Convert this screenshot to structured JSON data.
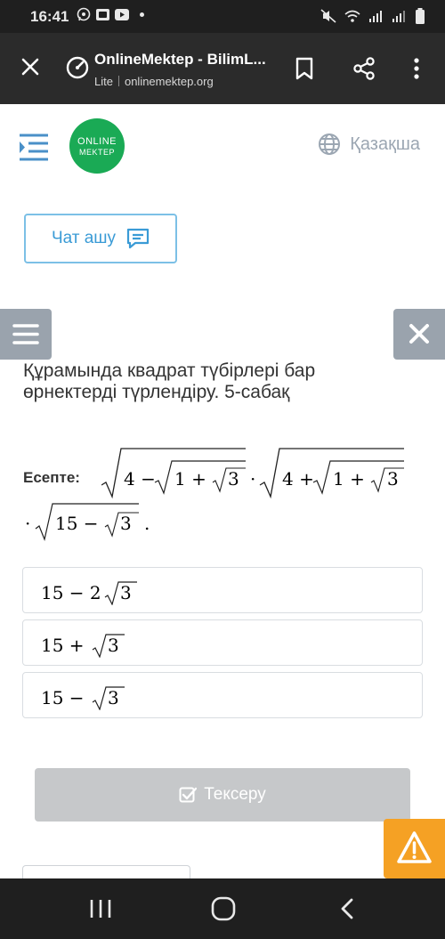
{
  "status_bar": {
    "time": "16:41",
    "left_icons": [
      "whatsapp-icon",
      "mail-icon",
      "youtube-icon",
      "notification-dot"
    ],
    "right_icons": [
      "mute-icon",
      "wifi-icon",
      "signal-icon",
      "signal-icon",
      "battery-icon"
    ]
  },
  "browser": {
    "title": "OnlineMektep - BilimL...",
    "mode": "Lite",
    "url": "onlinemektep.org"
  },
  "header": {
    "logo_line1": "ONLINE",
    "logo_line2": "MEKTEP",
    "language": "Қазақша"
  },
  "chat_button": {
    "label": "Чат ашу"
  },
  "lesson": {
    "title": "Құрамында квадрат түбірлері бар өрнектерді түрлендіру. 5-сабақ"
  },
  "task": {
    "label": "Есепте:",
    "expr": {
      "a": "4 −",
      "b": "1 +",
      "c": "3",
      "dot": "·",
      "d": "4 +",
      "e": "1 +",
      "f": "3",
      "g": "·",
      "h": "15 −",
      "i": "3",
      "end": "."
    }
  },
  "options": [
    {
      "prefix": "15 − 2",
      "radicand": "3"
    },
    {
      "prefix": "15 +",
      "radicand": "3"
    },
    {
      "prefix": "15 −",
      "radicand": "3"
    }
  ],
  "check_button": {
    "label": "Тексеру"
  },
  "colors": {
    "brand_green": "#1aaa55",
    "accent_blue": "#3a9bd6",
    "warning_orange": "#f5a124",
    "disabled_gray": "#c6c8ca"
  }
}
